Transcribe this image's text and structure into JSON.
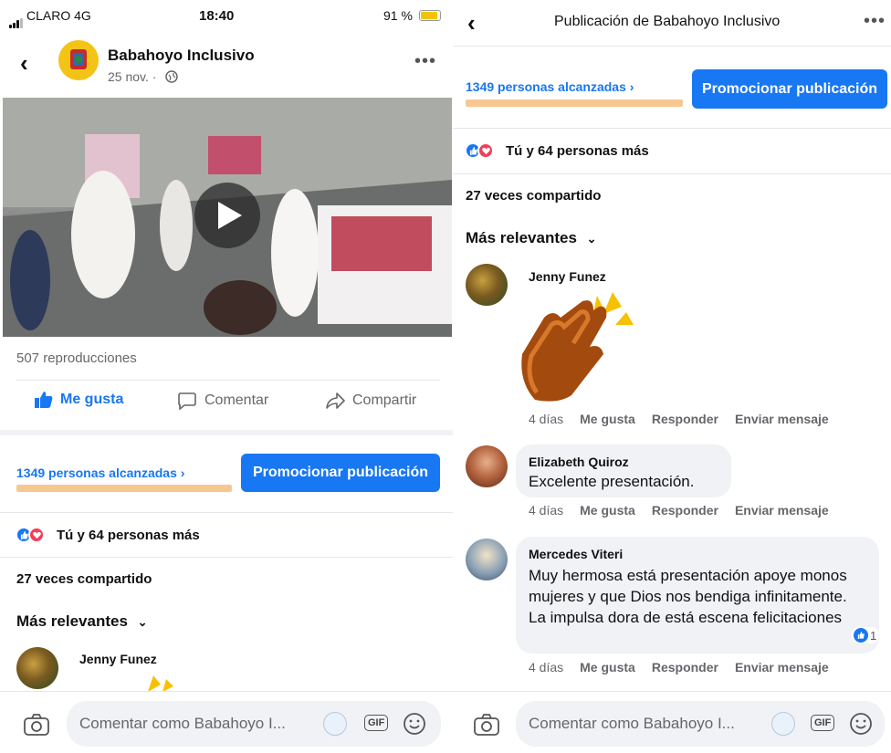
{
  "left": {
    "status": {
      "carrier": "CLARO 4G",
      "time": "18:40",
      "battery": "91 %"
    },
    "header": {
      "page_name": "Babahoyo Inclusivo",
      "date": "25 nov. ·",
      "more": "•••"
    },
    "video": {
      "views": "507 reproducciones"
    },
    "actions": {
      "like": "Me gusta",
      "comment": "Comentar",
      "share": "Compartir"
    },
    "promo": {
      "reach": "1349 personas alcanzadas ›",
      "button": "Promocionar publicación"
    },
    "reactions": "Tú y 64 personas más",
    "shares": "27 veces compartido",
    "filter": "Más relevantes",
    "first_comment": {
      "name": "Jenny Funez"
    },
    "composer": {
      "placeholder": "Comentar como Babahoyo I...",
      "gif": "GIF"
    }
  },
  "right": {
    "header": {
      "title": "Publicación de Babahoyo Inclusivo",
      "more": "•••"
    },
    "promo": {
      "reach": "1349 personas alcanzadas ›",
      "button": "Promocionar publicación"
    },
    "reactions": "Tú y 64 personas más",
    "shares": "27 veces compartido",
    "filter": "Más relevantes",
    "comments": [
      {
        "name": "Jenny Funez",
        "text": "",
        "time": "4 días",
        "like": "Me gusta",
        "reply": "Responder",
        "message": "Enviar mensaje"
      },
      {
        "name": "Elizabeth Quiroz",
        "text": "Excelente presentación.",
        "time": "4 días",
        "like": "Me gusta",
        "reply": "Responder",
        "message": "Enviar mensaje"
      },
      {
        "name": "Mercedes Viteri",
        "text": "Muy hermosa está presentación apoye monos mujeres y que Dios nos bendiga infinitamente. La impulsa dora de está escena felicitaciones",
        "time": "4 días",
        "like": "Me gusta",
        "reply": "Responder",
        "message": "Enviar mensaje",
        "reaction_count": "1"
      }
    ],
    "composer": {
      "placeholder": "Comentar como Babahoyo I...",
      "gif": "GIF"
    }
  },
  "colors": {
    "accent": "#1877f2",
    "love": "#f33e58",
    "reach_bar": "#f7c790",
    "battery": "#f5c400"
  },
  "icons": [
    "back-arrow-icon",
    "globe-icon",
    "play-icon",
    "like-icon",
    "comment-icon",
    "share-icon",
    "chevron-down-icon",
    "camera-icon",
    "emoji-icon",
    "clap-emoji-icon"
  ]
}
